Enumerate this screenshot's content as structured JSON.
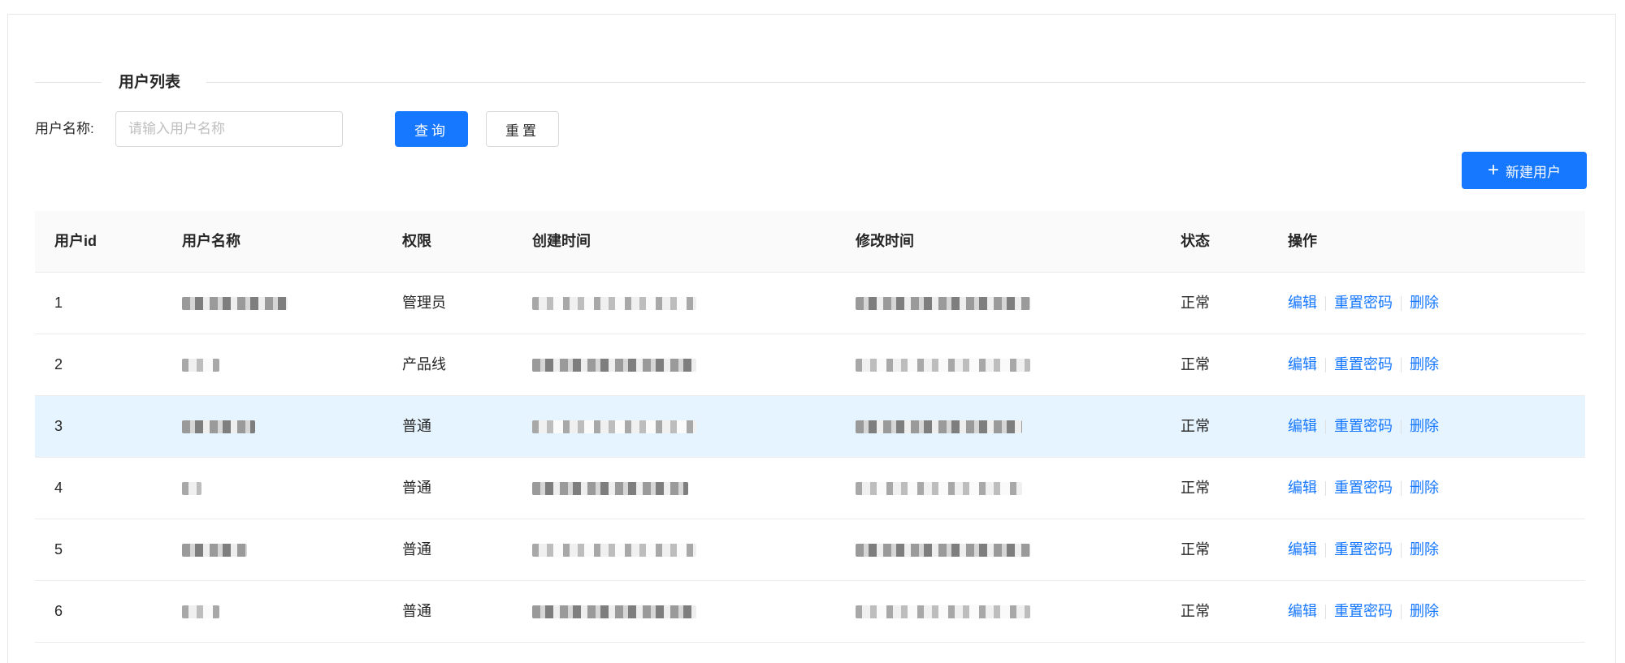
{
  "section": {
    "title": "用户列表"
  },
  "filter": {
    "label": "用户名称:",
    "placeholder": "请输入用户名称",
    "value": ""
  },
  "buttons": {
    "query": "查询",
    "reset": "重置",
    "new_user_icon": "plus-icon",
    "new_user": "新建用户"
  },
  "table": {
    "columns": [
      "用户id",
      "用户名称",
      "权限",
      "创建时间",
      "修改时间",
      "状态",
      "操作"
    ],
    "rows": [
      {
        "id": "1",
        "role": "管理员",
        "status": "正常",
        "highlighted": false
      },
      {
        "id": "2",
        "role": "产品线",
        "status": "正常",
        "highlighted": false
      },
      {
        "id": "3",
        "role": "普通",
        "status": "正常",
        "highlighted": true
      },
      {
        "id": "4",
        "role": "普通",
        "status": "正常",
        "highlighted": false
      },
      {
        "id": "5",
        "role": "普通",
        "status": "正常",
        "highlighted": false
      },
      {
        "id": "6",
        "role": "普通",
        "status": "正常",
        "highlighted": false
      }
    ],
    "actions": {
      "edit": "编辑",
      "reset_password": "重置密码",
      "delete": "删除"
    }
  },
  "colors": {
    "primary": "#1677ff",
    "row_highlight": "#e6f4ff",
    "header_bg": "#fafafa",
    "border": "#ececec"
  }
}
